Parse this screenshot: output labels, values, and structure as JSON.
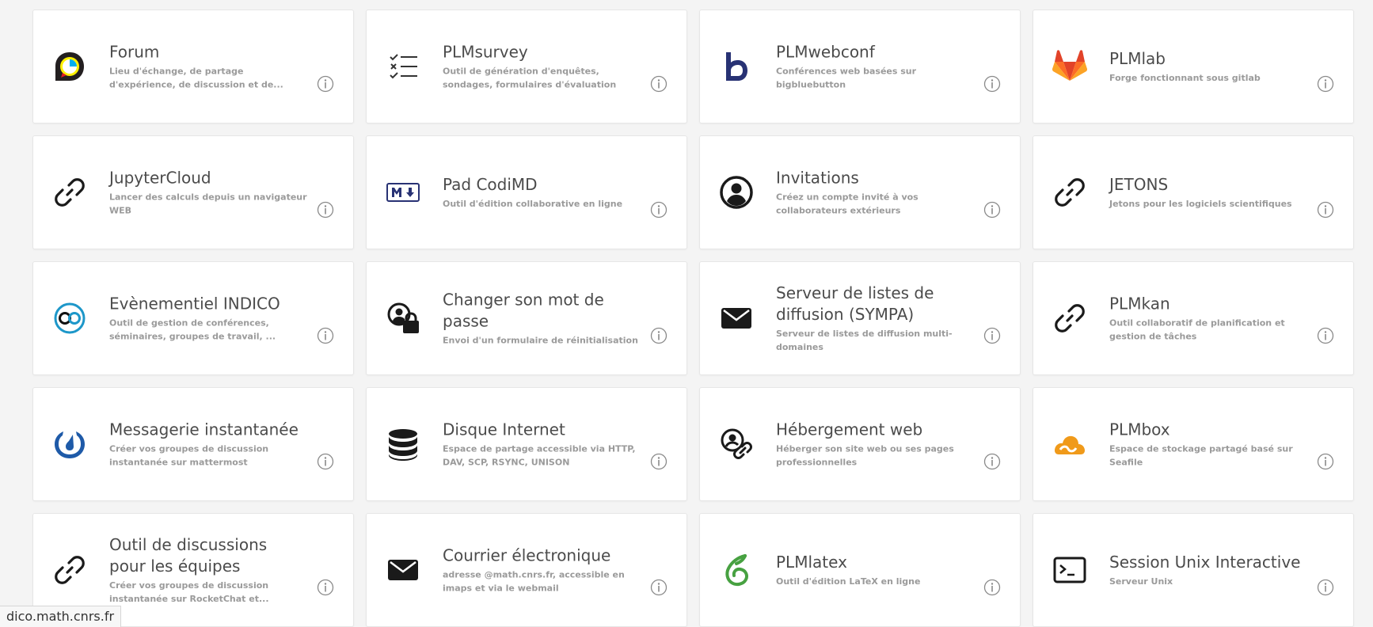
{
  "colors": {
    "card_bg": "#ffffff",
    "title": "#4b4b4b",
    "desc": "#9a9a9a",
    "bigbluebutton": "#283274",
    "gitlab": "#fc6d26",
    "indico": "#1d97c9",
    "mattermost": "#1e5aa8",
    "seafile": "#f09a1a",
    "overleaf": "#47a141"
  },
  "cards": [
    {
      "title": "Forum",
      "desc": "Lieu d'échange, de partage d'expérience, de discussion et de...",
      "icon": "discourse-icon"
    },
    {
      "title": "PLMsurvey",
      "desc": "Outil de génération d'enquêtes, sondages, formulaires d'évaluation",
      "icon": "checklist-icon"
    },
    {
      "title": "PLMwebconf",
      "desc": "Conférences web basées sur bigbluebutton",
      "icon": "bigbluebutton-icon"
    },
    {
      "title": "PLMlab",
      "desc": "Forge fonctionnant sous gitlab",
      "icon": "gitlab-icon"
    },
    {
      "title": "JupyterCloud",
      "desc": "Lancer des calculs depuis un navigateur WEB",
      "icon": "link-icon"
    },
    {
      "title": "Pad CodiMD",
      "desc": "Outil d'édition collaborative en ligne",
      "icon": "markdown-icon"
    },
    {
      "title": "Invitations",
      "desc": "Créez un compte invité à vos collaborateurs extérieurs",
      "icon": "user-circle-icon"
    },
    {
      "title": "JETONS",
      "desc": "Jetons pour les logiciels scientifiques",
      "icon": "link-icon"
    },
    {
      "title": "Evènementiel INDICO",
      "desc": "Outil de gestion de conférences, séminaires, groupes de travail, ...",
      "icon": "indico-icon"
    },
    {
      "title": "Changer son mot de passe",
      "desc": "Envoi d'un formulaire de réinitialisation",
      "icon": "user-lock-icon"
    },
    {
      "title": "Serveur de listes de diffusion (SYMPA)",
      "desc": "Serveur de listes de diffusion multi-domaines",
      "icon": "envelope-icon"
    },
    {
      "title": "PLMkan",
      "desc": "Outil collaboratif de planification et gestion de tâches",
      "icon": "link-icon"
    },
    {
      "title": "Messagerie instantanée",
      "desc": "Créer vos groupes de discussion instantanée sur mattermost",
      "icon": "mattermost-icon"
    },
    {
      "title": "Disque Internet",
      "desc": "Espace de partage accessible via HTTP, DAV, SCP, RSYNC, UNISON",
      "icon": "database-icon"
    },
    {
      "title": "Hébergement web",
      "desc": "Héberger son site web ou ses pages professionnelles",
      "icon": "user-link-icon"
    },
    {
      "title": "PLMbox",
      "desc": "Espace de stockage partagé basé sur Seafile",
      "icon": "seafile-icon"
    },
    {
      "title": "Outil de discussions pour les équipes",
      "desc": "Créer vos groupes de discussion instantanée sur RocketChat et...",
      "icon": "link-icon"
    },
    {
      "title": "Courrier électronique",
      "desc": "adresse @math.cnrs.fr, accessible en imaps et via le webmail",
      "icon": "envelope-icon"
    },
    {
      "title": "PLMlatex",
      "desc": "Outil d'édition LaTeX en ligne",
      "icon": "overleaf-icon"
    },
    {
      "title": "Session Unix Interactive",
      "desc": "Serveur Unix",
      "icon": "terminal-icon"
    }
  ],
  "status_bar": {
    "text": "dico.math.cnrs.fr"
  }
}
